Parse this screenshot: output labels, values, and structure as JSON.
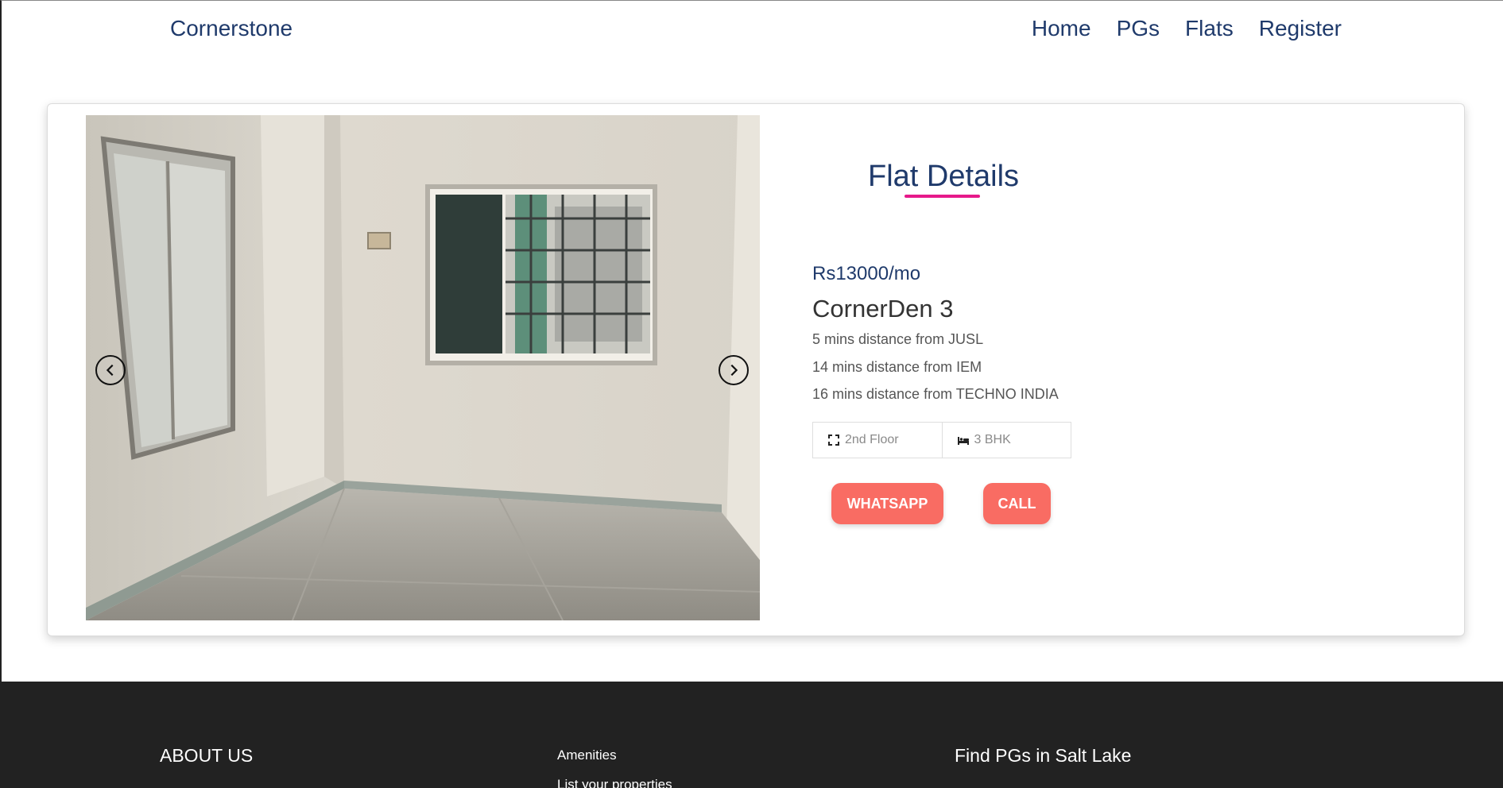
{
  "navbar": {
    "brand": "Cornerstone",
    "links": [
      {
        "label": "Home"
      },
      {
        "label": "PGs"
      },
      {
        "label": "Flats"
      },
      {
        "label": "Register"
      }
    ]
  },
  "carousel": {
    "prev_icon": "chevron-left-icon",
    "next_icon": "chevron-right-icon"
  },
  "details": {
    "title": "Flat Details",
    "price": "Rs13000/mo",
    "name": "CornerDen 3",
    "distances": [
      "5 mins distance from JUSL",
      "14 mins distance from IEM",
      "16 mins distance from TECHNO INDIA"
    ],
    "specs": {
      "floor": "2nd Floor",
      "floor_icon": "expand-icon",
      "bhk": "3 BHK",
      "bhk_icon": "bed-icon"
    },
    "buttons": {
      "whatsapp": "WHATSAPP",
      "call": "CALL"
    }
  },
  "footer": {
    "about": "ABOUT US",
    "links": [
      "Amenities",
      "List your properties"
    ],
    "find_pgs": "Find PGs in Salt Lake"
  },
  "colors": {
    "primary": "#1f3a6b",
    "accent_underline": "#e6198a",
    "button": "#f96c63",
    "footer_bg": "#222222"
  }
}
